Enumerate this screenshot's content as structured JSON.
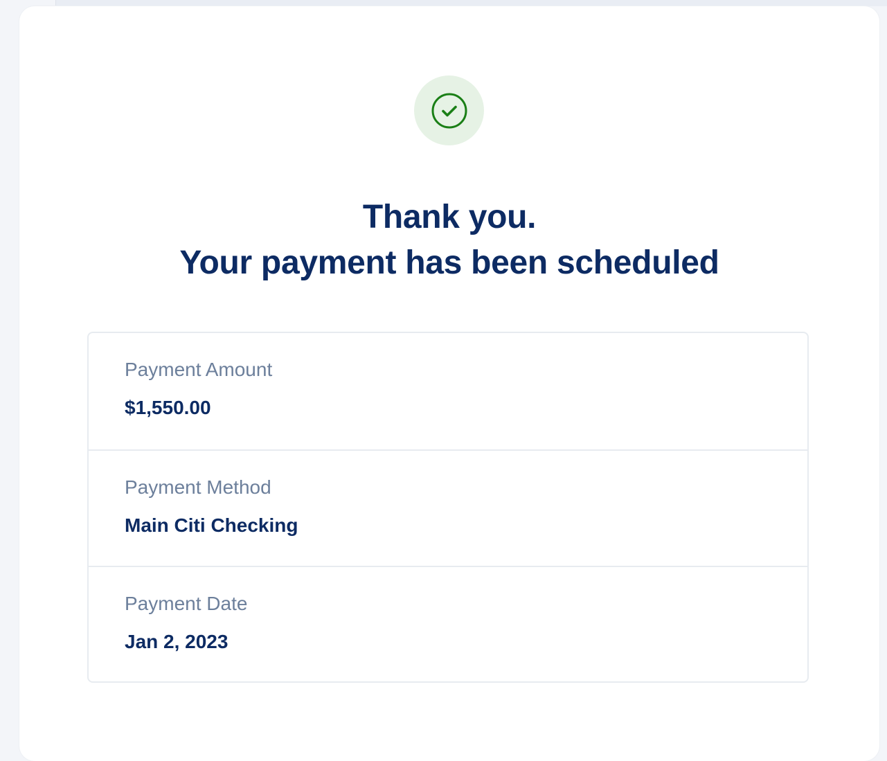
{
  "confirmation": {
    "icon": "check-circle-icon",
    "title_line_1": "Thank you.",
    "title_line_2": "Your payment has been scheduled",
    "details": [
      {
        "label": "Payment Amount",
        "value": "$1,550.00"
      },
      {
        "label": "Payment Method",
        "value": "Main Citi Checking"
      },
      {
        "label": "Payment Date",
        "value": "Jan 2, 2023"
      }
    ]
  },
  "colors": {
    "heading": "#0d2b63",
    "label": "#6c7f9b",
    "success": "#1a7f16",
    "success_bg": "#e6f2e5"
  }
}
